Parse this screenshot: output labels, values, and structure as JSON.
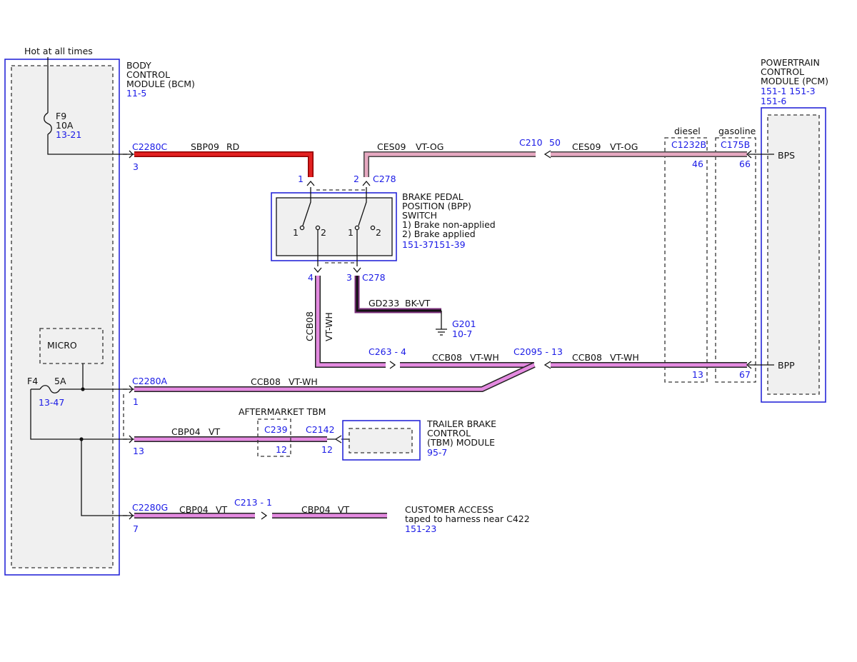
{
  "modules": {
    "bcm": {
      "line1": "BODY",
      "line2": "CONTROL",
      "line3": "MODULE (BCM)",
      "ref": "11-5"
    },
    "pcm": {
      "line1": "POWERTRAIN",
      "line2": "CONTROL",
      "line3": "MODULE (PCM)",
      "ref1": "151-1 151-3",
      "ref2": "151-6",
      "pin_bps": "BPS",
      "pin_bpp": "BPP"
    },
    "bpp_switch": {
      "line1": "BRAKE PEDAL",
      "line2": "POSITION (BPP)",
      "line3": "SWITCH",
      "line4": "1) Brake non-applied",
      "line5": "2) Brake applied",
      "ref": "151-37151-39"
    },
    "tbm": {
      "line1": "TRAILER BRAKE",
      "line2": "CONTROL",
      "line3": "(TBM) MODULE",
      "ref": "95-7"
    },
    "micro": "MICRO",
    "aftermarket_tbm": "AFTERMARKET TBM",
    "customer_access": {
      "line1": "CUSTOMER ACCESS",
      "line2": "taped to harness near C422",
      "ref": "151-23"
    }
  },
  "power": {
    "hot_label": "Hot at all times",
    "f9": {
      "name": "F9",
      "rating": "10A",
      "ref": "13-21"
    },
    "f4": {
      "name": "F4",
      "rating": "5A",
      "ref": "13-47"
    }
  },
  "variants": {
    "diesel": "diesel",
    "gasoline": "gasoline"
  },
  "connectors": {
    "c2280c": "C2280C",
    "c2280c_pin": "3",
    "c2280a": "C2280A",
    "c2280a_pin": "1",
    "c2280a_pin13": "13",
    "c2280g": "C2280G",
    "c2280g_pin": "7",
    "c278_top": "C278",
    "bpp_pin1": "1",
    "bpp_pin2": "2",
    "bpp_pin4": "4",
    "bpp_pin3": "3",
    "c278_bottom": "C278",
    "c210": "C210",
    "c210_pin": "50",
    "c1232b": "C1232B",
    "c1232b_pin46": "46",
    "c1232b_pin13": "13",
    "c175b": "C175B",
    "c175b_pin66": "66",
    "c175b_pin67": "67",
    "c263": "C263 - 4",
    "c2095": "C2095 - 13",
    "c239": "C239",
    "c239_pin": "12",
    "c2142": "C2142",
    "c2142_pin": "12",
    "c213": "C213 - 1",
    "g201": "G201",
    "g201_ref": "10-7"
  },
  "switch_contacts": {
    "a1": "1",
    "a2": "2",
    "b1": "1",
    "b2": "2"
  },
  "wires": {
    "sbp09": "SBP09",
    "sbp09_color": "RD",
    "ces09_left": "CES09",
    "ces09_left_color": "VT-OG",
    "ces09_right": "CES09",
    "ces09_right_color": "VT-OG",
    "ccb08_vertical": "CCB08",
    "ccb08_vertical_color": "VT-WH",
    "ccb08_mid": "CCB08",
    "ccb08_mid_color": "VT-WH",
    "ccb08_right": "CCB08",
    "ccb08_right_color": "VT-WH",
    "ccb08_bcm": "CCB08",
    "ccb08_bcm_color": "VT-WH",
    "gd233": "GD233",
    "gd233_color": "BK-VT",
    "cbp04_a": "CBP04",
    "cbp04_a_color": "VT",
    "cbp04_b": "CBP04",
    "cbp04_b_color": "VT",
    "cbp04_c": "CBP04",
    "cbp04_c_color": "VT"
  }
}
